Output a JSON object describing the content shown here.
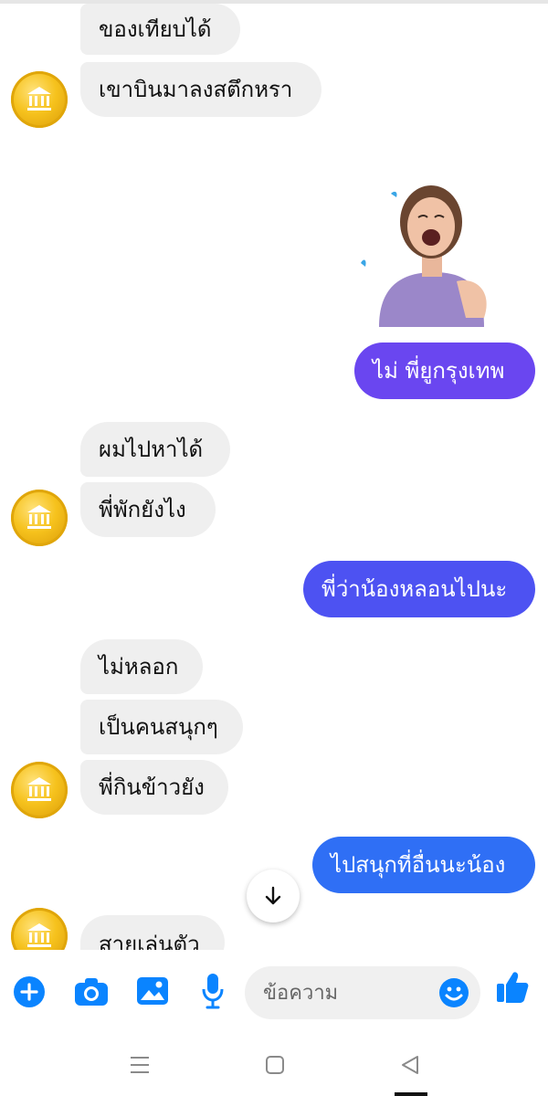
{
  "colors": {
    "incoming_bubble": "#efefef",
    "outgoing_purple": "#6a46f0",
    "outgoing_blue_1": "#4d52f2",
    "outgoing_blue_2": "#2f6ff5",
    "accent": "#0a84ff"
  },
  "messages": [
    {
      "text": "ของเทียบได้",
      "from": "contact"
    },
    {
      "text": "เขาบินมาลงสตึกหรา",
      "from": "contact"
    },
    {
      "sticker": "laughing-woman-sticker",
      "from": "me"
    },
    {
      "text": "ไม่ พี่ยูกรุงเทพ",
      "from": "me"
    },
    {
      "text": "ผมไปหาได้",
      "from": "contact"
    },
    {
      "text": "พี่พักยังไง",
      "from": "contact"
    },
    {
      "text": "พี่ว่าน้องหลอนไปนะ",
      "from": "me"
    },
    {
      "text": "ไม่หลอก",
      "from": "contact"
    },
    {
      "text": "เป็นคนสนุกๆ",
      "from": "contact"
    },
    {
      "text": "พี่กินข้าวยัง",
      "from": "contact"
    },
    {
      "text": "ไปสนุกที่อื่นนะน้อง",
      "from": "me"
    },
    {
      "text": "สายเล่นตัว",
      "from": "contact"
    }
  ],
  "composer": {
    "placeholder": "ข้อความ",
    "icons": [
      "plus-icon",
      "camera-icon",
      "gallery-icon",
      "microphone-icon",
      "emoji-icon",
      "like-icon"
    ]
  },
  "navigation": {
    "icons": [
      "menu-icon",
      "home-icon",
      "back-icon"
    ]
  }
}
